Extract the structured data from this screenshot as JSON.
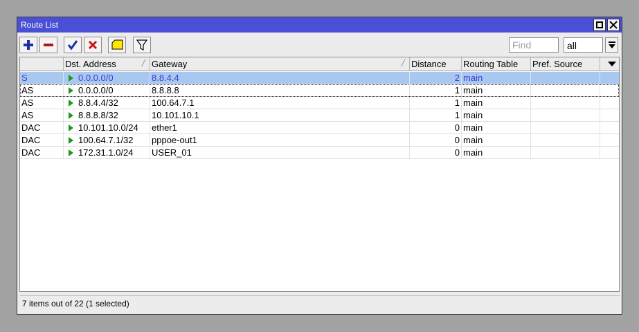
{
  "window": {
    "title": "Route List"
  },
  "toolbar": {
    "find_placeholder": "Find",
    "filter_value": "all"
  },
  "columns": [
    "",
    "Dst. Address",
    "Gateway",
    "Distance",
    "Routing Table",
    "Pref. Source"
  ],
  "rows": [
    {
      "flags": "S",
      "dst": "0.0.0.0/0",
      "gateway": "8.8.4.4",
      "distance": "2",
      "table": "main",
      "pref_source": ""
    },
    {
      "flags": "AS",
      "dst": "0.0.0.0/0",
      "gateway": "8.8.8.8",
      "distance": "1",
      "table": "main",
      "pref_source": ""
    },
    {
      "flags": "AS",
      "dst": "8.8.4.4/32",
      "gateway": "100.64.7.1",
      "distance": "1",
      "table": "main",
      "pref_source": ""
    },
    {
      "flags": "AS",
      "dst": "8.8.8.8/32",
      "gateway": "10.101.10.1",
      "distance": "1",
      "table": "main",
      "pref_source": ""
    },
    {
      "flags": "DAC",
      "dst": "10.101.10.0/24",
      "gateway": "ether1",
      "distance": "0",
      "table": "main",
      "pref_source": ""
    },
    {
      "flags": "DAC",
      "dst": "100.64.7.1/32",
      "gateway": "pppoe-out1",
      "distance": "0",
      "table": "main",
      "pref_source": ""
    },
    {
      "flags": "DAC",
      "dst": "172.31.1.0/24",
      "gateway": "USER_01",
      "distance": "0",
      "table": "main",
      "pref_source": ""
    }
  ],
  "status": {
    "text": "7 items out of 22 (1 selected)"
  },
  "colors": {
    "titlebar": "#4a50d6",
    "selected_row": "#a9c8f1",
    "selected_text": "#3b3bd6",
    "route_icon": "#1d9a1d"
  }
}
